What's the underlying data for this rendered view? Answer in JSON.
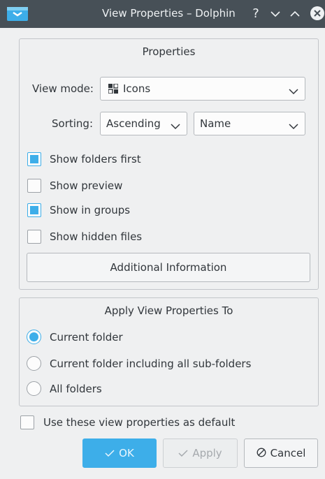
{
  "window": {
    "title": "View Properties – Dolphin",
    "help_glyph": "?"
  },
  "properties": {
    "title": "Properties",
    "view_mode_label": "View mode:",
    "view_mode_value": "Icons",
    "sorting_label": "Sorting:",
    "sort_order_value": "Ascending",
    "sort_by_value": "Name",
    "checkboxes": [
      {
        "label": "Show folders first",
        "checked": true
      },
      {
        "label": "Show preview",
        "checked": false
      },
      {
        "label": "Show in groups",
        "checked": true
      },
      {
        "label": "Show hidden files",
        "checked": false
      }
    ],
    "additional_info_label": "Additional Information"
  },
  "apply_to": {
    "title": "Apply View Properties To",
    "options": [
      {
        "label": "Current folder",
        "selected": true
      },
      {
        "label": "Current folder including all sub-folders",
        "selected": false
      },
      {
        "label": "All folders",
        "selected": false
      }
    ]
  },
  "default_checkbox": {
    "label": "Use these view properties as default",
    "checked": false
  },
  "buttons": {
    "ok_label": "OK",
    "apply_label": "Apply",
    "cancel_label": "Cancel"
  },
  "colors": {
    "accent": "#3daee9",
    "titlebar": "#475057",
    "background": "#eff0f1"
  }
}
